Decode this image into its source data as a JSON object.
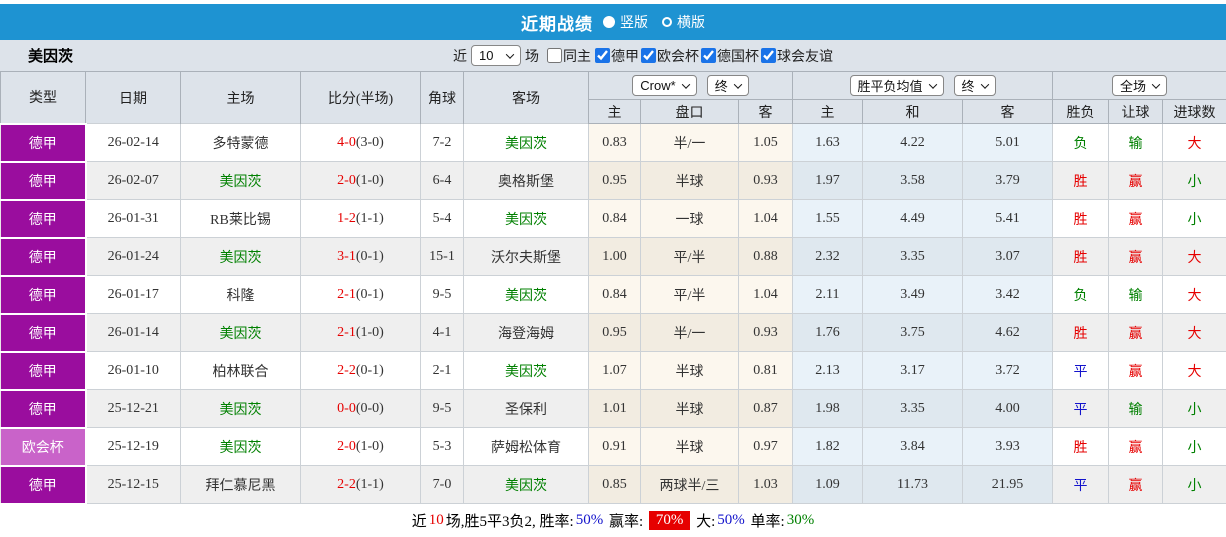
{
  "colors": {
    "topbar_blue": "#1e93d2",
    "league_purple": "#9a0d9e",
    "cup_purple": "#c963c9",
    "win_red": "#e60000",
    "lose_green": "#008000",
    "draw_blue": "#1414cc",
    "checkbox_blue": "#1a73e8"
  },
  "topbar": {
    "title": "近期战绩",
    "layout_options": [
      {
        "label": "竖版",
        "selected": true
      },
      {
        "label": "横版",
        "selected": false
      }
    ]
  },
  "filterbar": {
    "team": "美因茨",
    "recent_label": "近",
    "recent_value": "10",
    "recent_suffix": "场",
    "checkboxes": [
      {
        "label": "同主",
        "checked": false
      },
      {
        "label": "德甲",
        "checked": true
      },
      {
        "label": "欧会杯",
        "checked": true
      },
      {
        "label": "德国杯",
        "checked": true
      },
      {
        "label": "球会友谊",
        "checked": true
      }
    ]
  },
  "table": {
    "static_headers": [
      "类型",
      "日期",
      "主场",
      "比分(半场)",
      "角球",
      "客场"
    ],
    "odds_group": {
      "bookmaker_select": "Crow*",
      "time_select": "终",
      "sub_headers": [
        "主",
        "盘口",
        "客"
      ]
    },
    "avg_group": {
      "select": "胜平负均值",
      "time_select": "终",
      "sub_headers": [
        "主",
        "和",
        "客"
      ]
    },
    "result_group": {
      "select": "全场",
      "sub_headers": [
        "胜负",
        "让球",
        "进球数"
      ]
    },
    "rows": [
      {
        "type": "德甲",
        "type_class": "league",
        "date": "26-02-14",
        "home": "多特蒙德",
        "home_focus": false,
        "score_ft": "4-0",
        "score_ht": "(3-0)",
        "corners": "7-2",
        "away": "美因茨",
        "away_focus": true,
        "odds": [
          "0.83",
          "半/一",
          "1.05"
        ],
        "avg": [
          "1.63",
          "4.22",
          "5.01"
        ],
        "results": [
          {
            "text": "负",
            "c": "c-green"
          },
          {
            "text": "输",
            "c": "c-green"
          },
          {
            "text": "大",
            "c": "c-red"
          }
        ]
      },
      {
        "type": "德甲",
        "type_class": "league",
        "date": "26-02-07",
        "home": "美因茨",
        "home_focus": true,
        "score_ft": "2-0",
        "score_ht": "(1-0)",
        "corners": "6-4",
        "away": "奥格斯堡",
        "away_focus": false,
        "odds": [
          "0.95",
          "半球",
          "0.93"
        ],
        "avg": [
          "1.97",
          "3.58",
          "3.79"
        ],
        "results": [
          {
            "text": "胜",
            "c": "c-red"
          },
          {
            "text": "赢",
            "c": "c-red"
          },
          {
            "text": "小",
            "c": "c-green"
          }
        ]
      },
      {
        "type": "德甲",
        "type_class": "league",
        "date": "26-01-31",
        "home": "RB莱比锡",
        "home_focus": false,
        "score_ft": "1-2",
        "score_ht": "(1-1)",
        "corners": "5-4",
        "away": "美因茨",
        "away_focus": true,
        "odds": [
          "0.84",
          "一球",
          "1.04"
        ],
        "avg": [
          "1.55",
          "4.49",
          "5.41"
        ],
        "results": [
          {
            "text": "胜",
            "c": "c-red"
          },
          {
            "text": "赢",
            "c": "c-red"
          },
          {
            "text": "小",
            "c": "c-green"
          }
        ]
      },
      {
        "type": "德甲",
        "type_class": "league",
        "date": "26-01-24",
        "home": "美因茨",
        "home_focus": true,
        "score_ft": "3-1",
        "score_ht": "(0-1)",
        "corners": "15-1",
        "away": "沃尔夫斯堡",
        "away_focus": false,
        "odds": [
          "1.00",
          "平/半",
          "0.88"
        ],
        "avg": [
          "2.32",
          "3.35",
          "3.07"
        ],
        "results": [
          {
            "text": "胜",
            "c": "c-red"
          },
          {
            "text": "赢",
            "c": "c-red"
          },
          {
            "text": "大",
            "c": "c-red"
          }
        ]
      },
      {
        "type": "德甲",
        "type_class": "league",
        "date": "26-01-17",
        "home": "科隆",
        "home_focus": false,
        "score_ft": "2-1",
        "score_ht": "(0-1)",
        "corners": "9-5",
        "away": "美因茨",
        "away_focus": true,
        "odds": [
          "0.84",
          "平/半",
          "1.04"
        ],
        "avg": [
          "2.11",
          "3.49",
          "3.42"
        ],
        "results": [
          {
            "text": "负",
            "c": "c-green"
          },
          {
            "text": "输",
            "c": "c-green"
          },
          {
            "text": "大",
            "c": "c-red"
          }
        ]
      },
      {
        "type": "德甲",
        "type_class": "league",
        "date": "26-01-14",
        "home": "美因茨",
        "home_focus": true,
        "score_ft": "2-1",
        "score_ht": "(1-0)",
        "corners": "4-1",
        "away": "海登海姆",
        "away_focus": false,
        "odds": [
          "0.95",
          "半/一",
          "0.93"
        ],
        "avg": [
          "1.76",
          "3.75",
          "4.62"
        ],
        "results": [
          {
            "text": "胜",
            "c": "c-red"
          },
          {
            "text": "赢",
            "c": "c-red"
          },
          {
            "text": "大",
            "c": "c-red"
          }
        ]
      },
      {
        "type": "德甲",
        "type_class": "league",
        "date": "26-01-10",
        "home": "柏林联合",
        "home_focus": false,
        "score_ft": "2-2",
        "score_ht": "(0-1)",
        "corners": "2-1",
        "away": "美因茨",
        "away_focus": true,
        "odds": [
          "1.07",
          "半球",
          "0.81"
        ],
        "avg": [
          "2.13",
          "3.17",
          "3.72"
        ],
        "results": [
          {
            "text": "平",
            "c": "c-blue"
          },
          {
            "text": "赢",
            "c": "c-red"
          },
          {
            "text": "大",
            "c": "c-red"
          }
        ]
      },
      {
        "type": "德甲",
        "type_class": "league",
        "date": "25-12-21",
        "home": "美因茨",
        "home_focus": true,
        "score_ft": "0-0",
        "score_ht": "(0-0)",
        "corners": "9-5",
        "away": "圣保利",
        "away_focus": false,
        "odds": [
          "1.01",
          "半球",
          "0.87"
        ],
        "avg": [
          "1.98",
          "3.35",
          "4.00"
        ],
        "results": [
          {
            "text": "平",
            "c": "c-blue"
          },
          {
            "text": "输",
            "c": "c-green"
          },
          {
            "text": "小",
            "c": "c-green"
          }
        ]
      },
      {
        "type": "欧会杯",
        "type_class": "cup",
        "date": "25-12-19",
        "home": "美因茨",
        "home_focus": true,
        "score_ft": "2-0",
        "score_ht": "(1-0)",
        "corners": "5-3",
        "away": "萨姆松体育",
        "away_focus": false,
        "odds": [
          "0.91",
          "半球",
          "0.97"
        ],
        "avg": [
          "1.82",
          "3.84",
          "3.93"
        ],
        "results": [
          {
            "text": "胜",
            "c": "c-red"
          },
          {
            "text": "赢",
            "c": "c-red"
          },
          {
            "text": "小",
            "c": "c-green"
          }
        ]
      },
      {
        "type": "德甲",
        "type_class": "league",
        "date": "25-12-15",
        "home": "拜仁慕尼黑",
        "home_focus": false,
        "score_ft": "2-2",
        "score_ht": "(1-1)",
        "corners": "7-0",
        "away": "美因茨",
        "away_focus": true,
        "odds": [
          "0.85",
          "两球半/三",
          "1.03"
        ],
        "avg": [
          "1.09",
          "11.73",
          "21.95"
        ],
        "results": [
          {
            "text": "平",
            "c": "c-blue"
          },
          {
            "text": "赢",
            "c": "c-red"
          },
          {
            "text": "小",
            "c": "c-green"
          }
        ]
      }
    ]
  },
  "footer": {
    "segments": [
      {
        "text": "近",
        "cls": ""
      },
      {
        "text": "10",
        "cls": "num-red"
      },
      {
        "text": "场,胜5平3负2, 胜率:",
        "cls": ""
      },
      {
        "text": "50%",
        "cls": "pct-blue"
      },
      {
        "text": " 赢率: ",
        "cls": ""
      },
      {
        "text": "70%",
        "cls": "hl-red"
      },
      {
        "text": " 大:",
        "cls": ""
      },
      {
        "text": "50%",
        "cls": "pct-blue"
      },
      {
        "text": " 单率:",
        "cls": ""
      },
      {
        "text": "30%",
        "cls": "pct-green"
      }
    ]
  }
}
